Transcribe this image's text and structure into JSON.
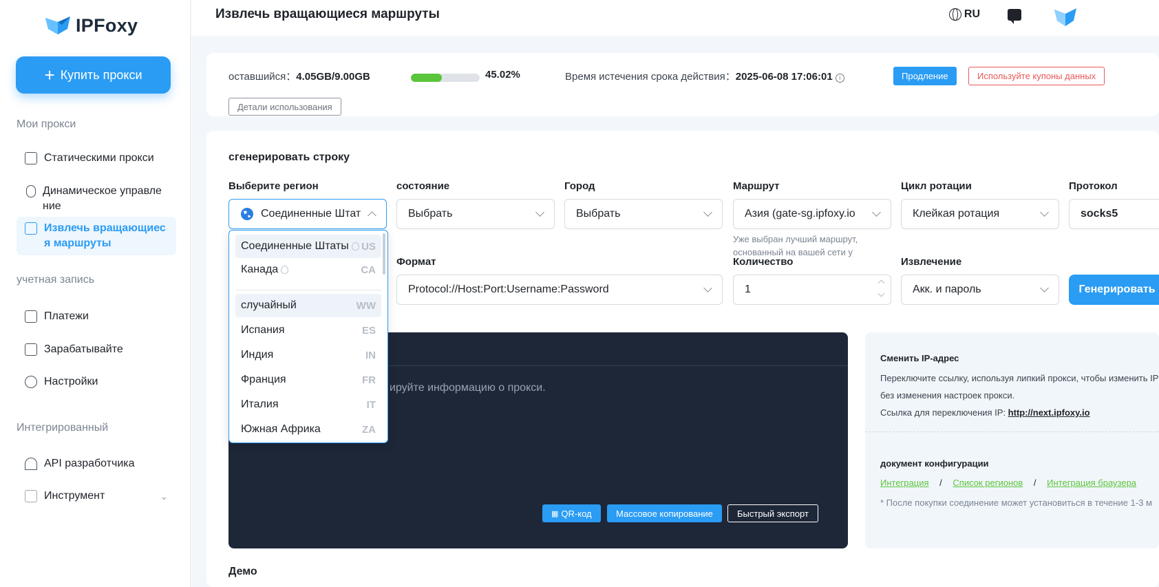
{
  "brand": {
    "name": "IPFoxy"
  },
  "sidebar": {
    "buy_button": "Купить прокси",
    "section_proxies": "Мои прокси",
    "item_static": "Статическими прокси",
    "item_dynamic": "Динамическое управле ние",
    "item_extract": "Извлечь вращающиес я маршруты",
    "section_account": "учетная запись",
    "item_payments": "Платежи",
    "item_earn": "Зарабатывайте",
    "item_settings": "Настройки",
    "section_integrated": "Интегрированный",
    "item_api": "API разработчика",
    "item_tool": "Инструмент"
  },
  "topbar": {
    "title": "Извлечь вращающиеся маршруты",
    "lang": "RU"
  },
  "usage": {
    "remaining_label": "оставшийся：",
    "remaining_value": "4.05GB/9.00GB",
    "used_percent": 45.02,
    "percent_text": "45.02%",
    "expiry_label": "Время истечения срока действия：",
    "expiry_value": "2025-06-08 17:06:01",
    "renew_button": "Продление",
    "coupon_button": "Используйте купоны данных",
    "details_button": "Детали использования"
  },
  "generator": {
    "section_title": "сгенерировать строку",
    "region_label": "Выберите регион",
    "region_value": "Соединенные Штат",
    "state_label": "состояние",
    "state_value": "Выбрать",
    "city_label": "Город",
    "city_value": "Выбрать",
    "route_label": "Маршрут",
    "route_value": "Азия (gate-sg.ipfoxy.io",
    "route_note": "Уже выбран лучший маршрут, основанный на вашей сети у",
    "rotation_label": "Цикл ротации",
    "rotation_value": "Клейкая ротация",
    "protocol_label": "Протокол",
    "protocol_value": "socks5",
    "format_label": "Формат",
    "format_value": "Protocol://Host:Port:Username:Password",
    "quantity_label": "Количество",
    "quantity_value": "1",
    "extract_label": "Извлечение",
    "extract_value": "Акк. и пароль",
    "generate_button": "Генерировать"
  },
  "region_dropdown": {
    "items": [
      {
        "name": "Соединенные Штаты",
        "code": "US"
      },
      {
        "name": "Канада",
        "code": "CA"
      },
      {
        "name": "случайный",
        "code": "WW"
      },
      {
        "name": "Испания",
        "code": "ES"
      },
      {
        "name": "Индия",
        "code": "IN"
      },
      {
        "name": "Франция",
        "code": "FR"
      },
      {
        "name": "Италия",
        "code": "IT"
      },
      {
        "name": "Южная Африка",
        "code": "ZA"
      }
    ]
  },
  "output": {
    "hint": "ируйте информацию о прокси.",
    "qr_button": "QR-код",
    "copy_button": "Массовое копирование",
    "export_button": "Быстрый экспорт"
  },
  "info": {
    "change_ip_title": "Сменить IP-адрес",
    "change_ip_text1": "Переключите ссылку, используя липкий прокси, чтобы изменить IP",
    "change_ip_text2": "без изменения настроек прокси.",
    "switch_link_label": "Ссылка для переключения IP: ",
    "switch_link": "http://next.ipfoxy.io",
    "config_title": "документ конфигурации",
    "link_integration": "Интеграция",
    "link_regions": "Список регионов",
    "link_browser": "Интеграция браузера",
    "slash": "/",
    "footnote": "* После покупки соединение может установиться в течение 1-3 м"
  },
  "demo": {
    "title": "Демо"
  },
  "colors": {
    "accent": "#2a9cf4",
    "progress": "#5bc53b",
    "danger": "#e95858",
    "dark": "#1e2738"
  }
}
